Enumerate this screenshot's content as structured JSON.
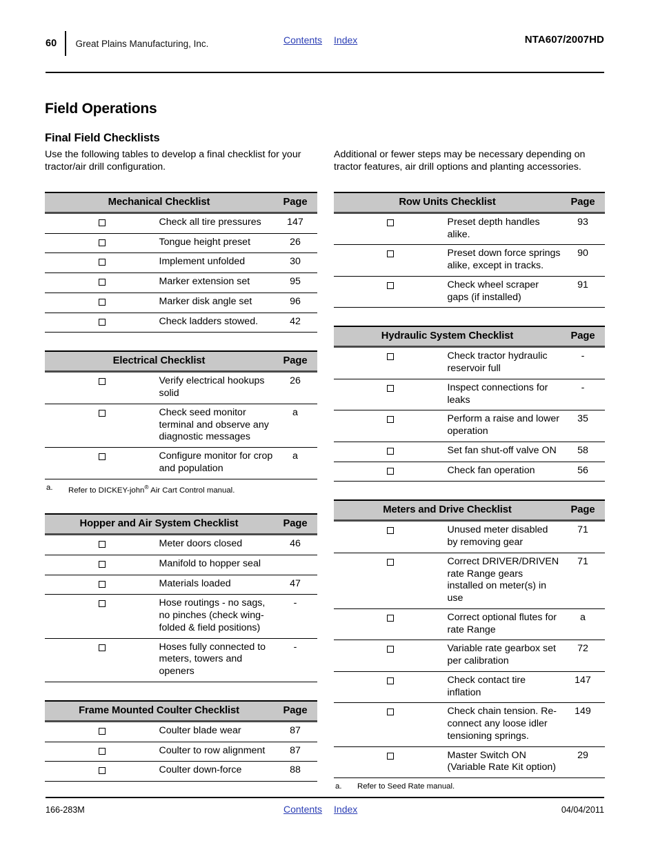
{
  "header": {
    "page_number": "60",
    "company": "Great Plains Manufacturing, Inc.",
    "contents_link": "Contents",
    "index_link": "Index",
    "model": "NTA607/2007HD"
  },
  "footer": {
    "doc_number": "166-283M",
    "contents_link": "Contents",
    "index_link": "Index",
    "date": "04/04/2011"
  },
  "titles": {
    "main": "Field Operations",
    "sub": "Final Field Checklists"
  },
  "intro": {
    "left": "Use the following tables to develop a final checklist for your tractor/air drill configuration.",
    "right": "Additional or fewer steps may be necessary depending on tractor features, air drill options and planting accessories."
  },
  "page_column_header": "Page",
  "tables": {
    "mechanical": {
      "title": "Mechanical Checklist",
      "rows": [
        {
          "task": "Check all tire pressures",
          "page": "147"
        },
        {
          "task": "Tongue height preset",
          "page": "26"
        },
        {
          "task": "Implement unfolded",
          "page": "30"
        },
        {
          "task": "Marker extension set",
          "page": "95"
        },
        {
          "task": "Marker disk angle set",
          "page": "96"
        },
        {
          "task": "Check ladders stowed.",
          "page": "42"
        }
      ]
    },
    "electrical": {
      "title": "Electrical Checklist",
      "rows": [
        {
          "task": "Verify electrical hookups solid",
          "page": "26"
        },
        {
          "task": "Check seed monitor terminal and observe any diagnostic messages",
          "page": "a"
        },
        {
          "task": "Configure monitor for crop and population",
          "page": "a"
        }
      ],
      "footnote_mark": "a.",
      "footnote_pre": "Refer to DICKEY-john",
      "footnote_sup": "®",
      "footnote_post": " Air Cart Control manual."
    },
    "hopper": {
      "title": "Hopper and Air System Checklist",
      "rows": [
        {
          "task": "Meter doors closed",
          "page": "46"
        },
        {
          "task": "Manifold to hopper seal",
          "page": ""
        },
        {
          "task": "Materials loaded",
          "page": "47"
        },
        {
          "task": "Hose routings - no sags, no pinches (check wing-folded & field positions)",
          "page": "-"
        },
        {
          "task": "Hoses fully connected to meters, towers and openers",
          "page": "-"
        }
      ]
    },
    "coulter": {
      "title": "Frame Mounted Coulter Checklist",
      "rows": [
        {
          "task": "Coulter blade wear",
          "page": "87"
        },
        {
          "task": "Coulter to row alignment",
          "page": "87"
        },
        {
          "task": "Coulter down-force",
          "page": "88"
        }
      ]
    },
    "row_units": {
      "title": "Row Units Checklist",
      "rows": [
        {
          "task": "Preset depth handles alike.",
          "page": "93"
        },
        {
          "task": "Preset down force springs alike, except in tracks.",
          "page": "90"
        },
        {
          "task": "Check wheel scraper gaps (if installed)",
          "page": "91"
        }
      ]
    },
    "hydraulic": {
      "title": "Hydraulic System Checklist",
      "rows": [
        {
          "task": "Check tractor hydraulic reservoir full",
          "page": "-"
        },
        {
          "task": "Inspect connections for leaks",
          "page": "-"
        },
        {
          "task": "Perform a raise and lower operation",
          "page": "35"
        },
        {
          "task": "Set fan shut-off valve ON",
          "page": "58"
        },
        {
          "task": "Check fan operation",
          "page": "56"
        }
      ]
    },
    "meters": {
      "title": "Meters and Drive Checklist",
      "rows": [
        {
          "task": "Unused meter disabled by removing gear",
          "page": "71"
        },
        {
          "task": "Correct DRIVER/DRIVEN rate Range gears installed on meter(s) in use",
          "page": "71"
        },
        {
          "task": "Correct optional flutes for rate Range",
          "page": "a"
        },
        {
          "task": "Variable rate gearbox set per calibration",
          "page": "72"
        },
        {
          "task": "Check contact tire inflation",
          "page": "147"
        },
        {
          "task": "Check chain tension. Re-connect any loose idler tensioning springs.",
          "page": "149"
        },
        {
          "task": "Master Switch ON\n(Variable Rate Kit option)",
          "page": "29"
        }
      ],
      "footnote_mark": "a.",
      "footnote_text": "Refer to Seed Rate manual."
    }
  }
}
